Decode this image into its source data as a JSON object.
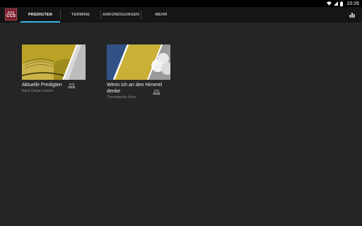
{
  "status": {
    "time": "10:26",
    "icons": [
      "wifi-icon",
      "signal-icon",
      "battery-icon"
    ]
  },
  "app": {
    "logo_text": "CCS",
    "accent": "#38b6e8",
    "logo_color": "#7a1e2b"
  },
  "tabs": [
    {
      "label": "PREDIGTEN",
      "active": true
    },
    {
      "label": "TERMINE",
      "active": false
    },
    {
      "label": "ANKÜNDIGUNGEN",
      "active": false
    },
    {
      "label": "MEHR",
      "active": false
    }
  ],
  "toolbar": {
    "stats_icon": "bar-chart-icon"
  },
  "cards": [
    {
      "title": "Aktuelle Predigten",
      "subtitle": "Nach Datum sortiert",
      "badge": "CCS",
      "image": "open-bible"
    },
    {
      "title": "Wenn ich an den Himmel denke",
      "subtitle": "Thematische Serie",
      "badge": "CCS",
      "image": "sky-clouds"
    }
  ]
}
